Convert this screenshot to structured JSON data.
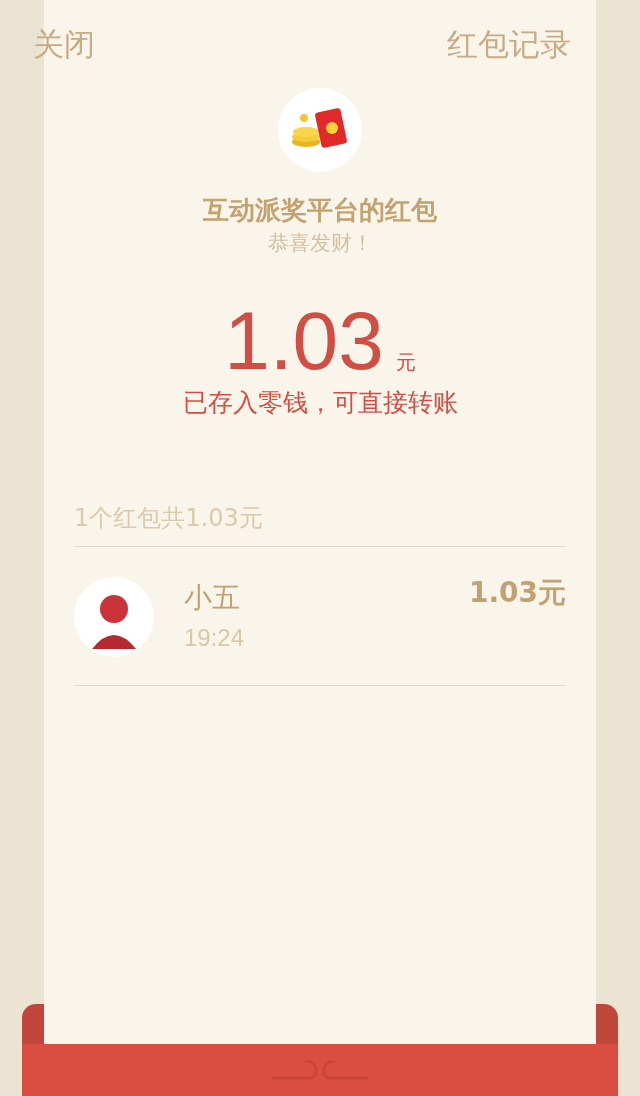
{
  "header": {
    "close": "关闭",
    "records": "红包记录"
  },
  "packet": {
    "sender_title": "互动派奖平台的红包",
    "greeting": "恭喜发财！",
    "amount": "1.03",
    "unit": "元",
    "note": "已存入零钱，可直接转账"
  },
  "summary": "1个红包共1.03元",
  "receivers": [
    {
      "name": "小五",
      "time": "19:24",
      "amount": "1.03元"
    }
  ]
}
